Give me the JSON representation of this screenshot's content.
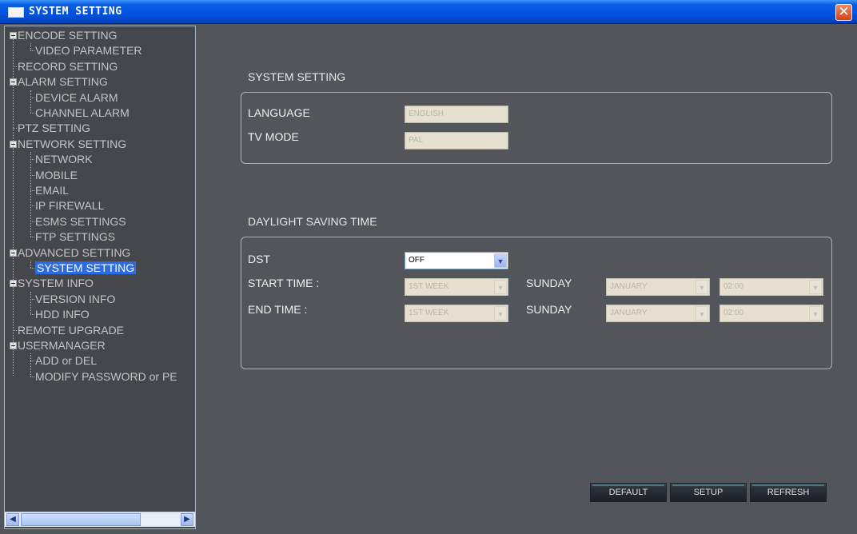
{
  "window": {
    "title": "SYSTEM SETTING",
    "close_symbol": "✕"
  },
  "tree": {
    "items": [
      {
        "label": "ENCODE SETTING",
        "level": 0,
        "expandable": true
      },
      {
        "label": "VIDEO PARAMETER",
        "level": 1
      },
      {
        "label": "RECORD SETTING",
        "level": 0
      },
      {
        "label": "ALARM SETTING",
        "level": 0,
        "expandable": true
      },
      {
        "label": "DEVICE ALARM",
        "level": 1
      },
      {
        "label": "CHANNEL ALARM",
        "level": 1
      },
      {
        "label": "PTZ SETTING",
        "level": 0
      },
      {
        "label": "NETWORK SETTING",
        "level": 0,
        "expandable": true
      },
      {
        "label": "NETWORK",
        "level": 1
      },
      {
        "label": "MOBILE",
        "level": 1
      },
      {
        "label": "EMAIL",
        "level": 1
      },
      {
        "label": "IP FIREWALL",
        "level": 1
      },
      {
        "label": "ESMS SETTINGS",
        "level": 1
      },
      {
        "label": "FTP SETTINGS",
        "level": 1
      },
      {
        "label": "ADVANCED SETTING",
        "level": 0,
        "expandable": true
      },
      {
        "label": "SYSTEM SETTING",
        "level": 1,
        "selected": true
      },
      {
        "label": "SYSTEM INFO",
        "level": 0,
        "expandable": true
      },
      {
        "label": "VERSION INFO",
        "level": 1
      },
      {
        "label": "HDD INFO",
        "level": 1
      },
      {
        "label": "REMOTE UPGRADE",
        "level": 0
      },
      {
        "label": "USERMANAGER",
        "level": 0,
        "expandable": true
      },
      {
        "label": "ADD or DEL",
        "level": 1
      },
      {
        "label": "MODIFY PASSWORD or PE",
        "level": 1
      }
    ],
    "scroll": {
      "left_arrow": "◀",
      "right_arrow": "▶"
    }
  },
  "system_setting": {
    "section_title": "SYSTEM SETTING",
    "language_label": "LANGUAGE",
    "language_value": "ENGLISH",
    "tv_mode_label": "TV MODE",
    "tv_mode_value": "PAL"
  },
  "dst": {
    "section_title": "DAYLIGHT SAVING TIME",
    "dst_label": "DST",
    "dst_value": "OFF",
    "start_label": "START TIME :",
    "start_week": "1ST WEEK",
    "start_day": "SUNDAY",
    "start_month": "JANUARY",
    "start_time": "02:00",
    "end_label": "END TIME :",
    "end_week": "1ST WEEK",
    "end_day": "SUNDAY",
    "end_month": "JANUARY",
    "end_time": "02:00",
    "arrow": "▼"
  },
  "buttons": {
    "default": "DEFAULT",
    "setup": "SETUP",
    "refresh": "REFRESH"
  },
  "colors": {
    "titlebar": "#0054e3",
    "panel_bg": "#52565a",
    "sidebar_bg": "#44484c",
    "selection": "#2e6ae0"
  }
}
